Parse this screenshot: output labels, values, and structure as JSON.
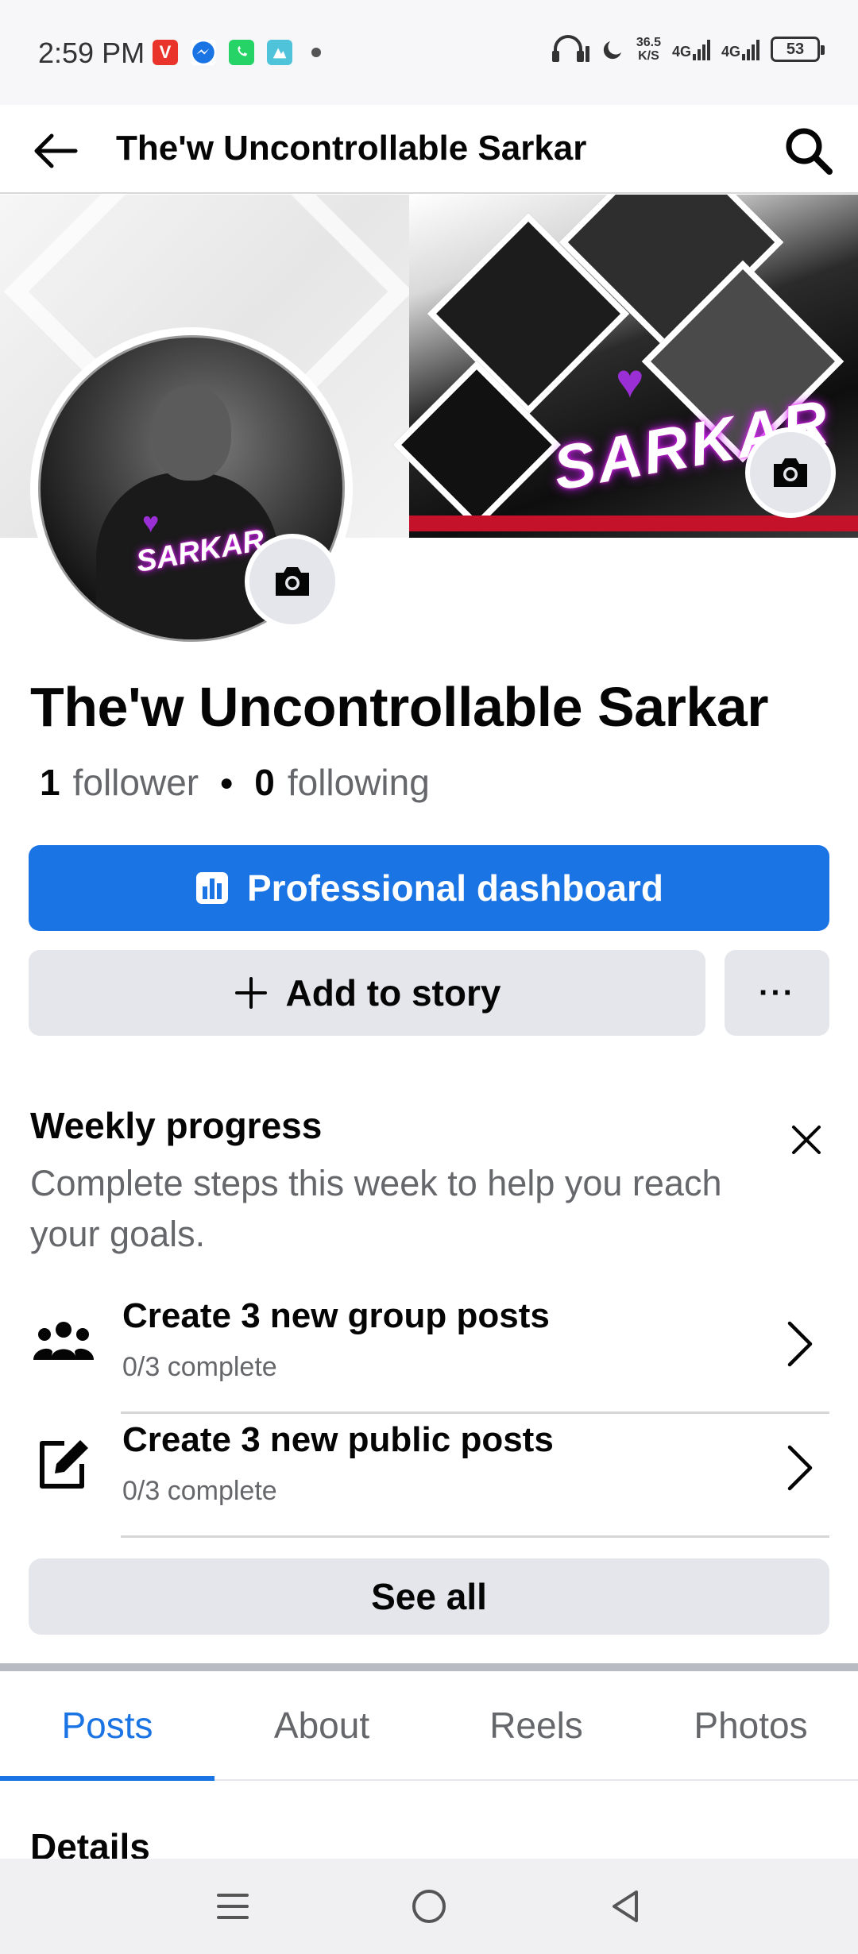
{
  "status_bar": {
    "time": "2:59 PM",
    "speed_value": "36.5",
    "speed_unit": "K/S",
    "net1": "4G",
    "net2": "4G",
    "battery": "53",
    "app_icons": [
      "vivaldi-icon",
      "messenger-icon",
      "whatsapp-icon",
      "gallery-app-icon"
    ]
  },
  "appbar": {
    "title": "The'w Uncontrollable Sarkar"
  },
  "cover": {
    "graphic_text": "SARKAR"
  },
  "avatar": {
    "graphic_text": "SARKAR"
  },
  "profile": {
    "name": "The'w Uncontrollable Sarkar",
    "followers_count": "1",
    "followers_label": "follower",
    "following_count": "0",
    "following_label": "following"
  },
  "actions": {
    "dashboard_label": "Professional dashboard",
    "add_story_label": "Add to story",
    "more_label": "···"
  },
  "weekly_progress": {
    "title": "Weekly progress",
    "subtitle": "Complete steps this week to help you reach your goals.",
    "tasks": [
      {
        "title": "Create 3 new group posts",
        "status": "0/3 complete",
        "icon": "group-icon"
      },
      {
        "title": "Create 3 new public posts",
        "status": "0/3 complete",
        "icon": "edit-post-icon"
      }
    ],
    "see_all_label": "See all"
  },
  "tabs": [
    {
      "label": "Posts",
      "active": true
    },
    {
      "label": "About",
      "active": false
    },
    {
      "label": "Reels",
      "active": false
    },
    {
      "label": "Photos",
      "active": false
    }
  ],
  "details_heading": "Details",
  "colors": {
    "primary": "#1b74e4",
    "secondary_bg": "#e4e6eb",
    "muted_text": "#65676b"
  }
}
